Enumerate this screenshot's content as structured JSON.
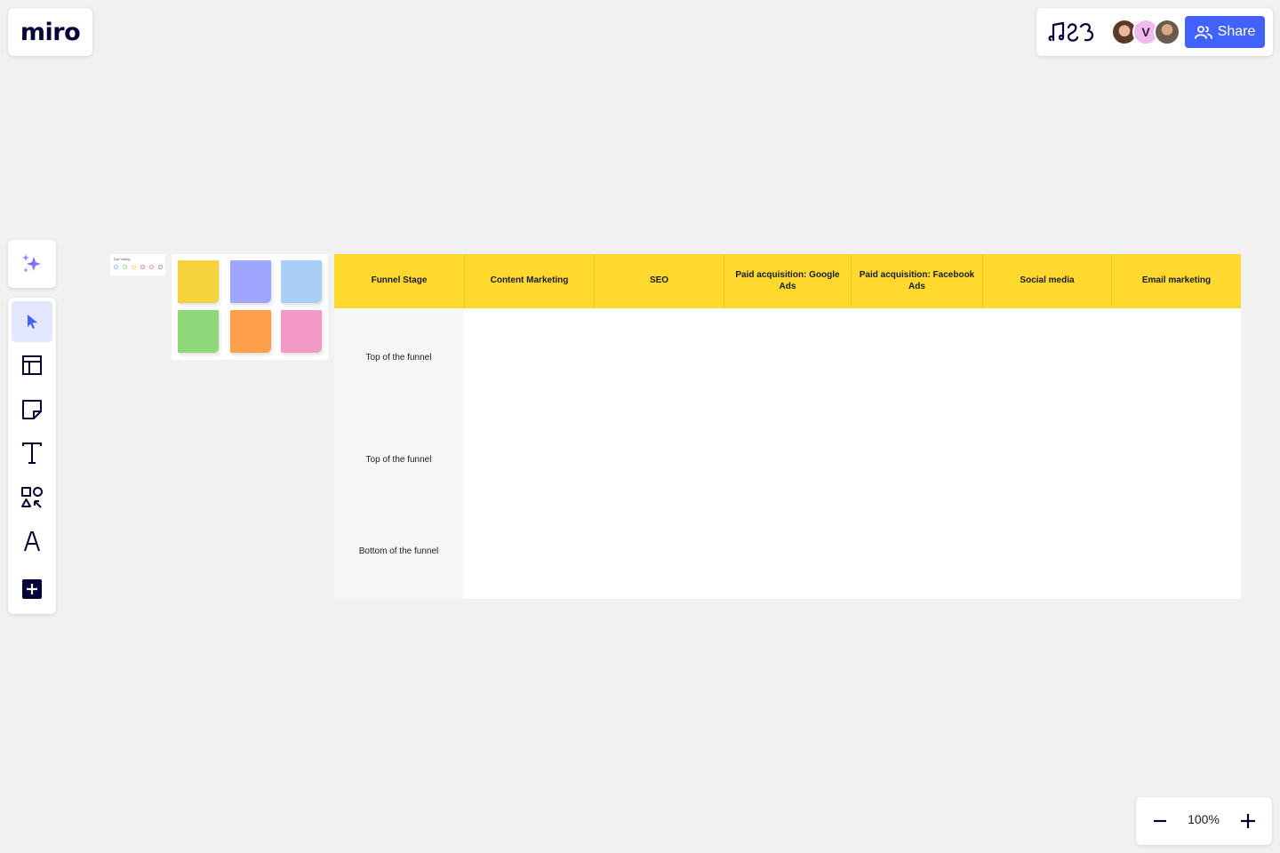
{
  "app": {
    "logo": "miro"
  },
  "topbar": {
    "share_label": "Share",
    "avatars": [
      {
        "name": "avatar-1",
        "initial": ""
      },
      {
        "name": "avatar-2",
        "initial": "V"
      },
      {
        "name": "avatar-3",
        "initial": ""
      }
    ]
  },
  "toolbar": {
    "tools": [
      "select",
      "templates",
      "sticky-note",
      "text",
      "shapes",
      "pen",
      "more"
    ]
  },
  "zoom": {
    "value": "100%"
  },
  "voting_widget": {
    "title": "Dot Voting",
    "dot_colors": [
      "#7fc8f8",
      "#8fe08f",
      "#f8d86a",
      "#f88a8a",
      "#d88af8",
      "#8a9af8"
    ]
  },
  "sticky_colors": [
    "#f5d23a",
    "#9ea6ff",
    "#a8cff8",
    "#8ed87a",
    "#ff9f4a",
    "#f39ac8"
  ],
  "table": {
    "headers": [
      "Funnel Stage",
      "Content Marketing",
      "SEO",
      "Paid acquisition: Google Ads",
      "Paid acquisition: Facebook Ads",
      "Social media",
      "Email marketing"
    ],
    "rows": [
      {
        "label": "Top of the funnel"
      },
      {
        "label": "Top of the funnel"
      },
      {
        "label": "Bottom of the funnel"
      }
    ],
    "header_color": "#ffd92e"
  },
  "colors": {
    "accent": "#4262ff",
    "canvas": "#f1f1f1"
  }
}
